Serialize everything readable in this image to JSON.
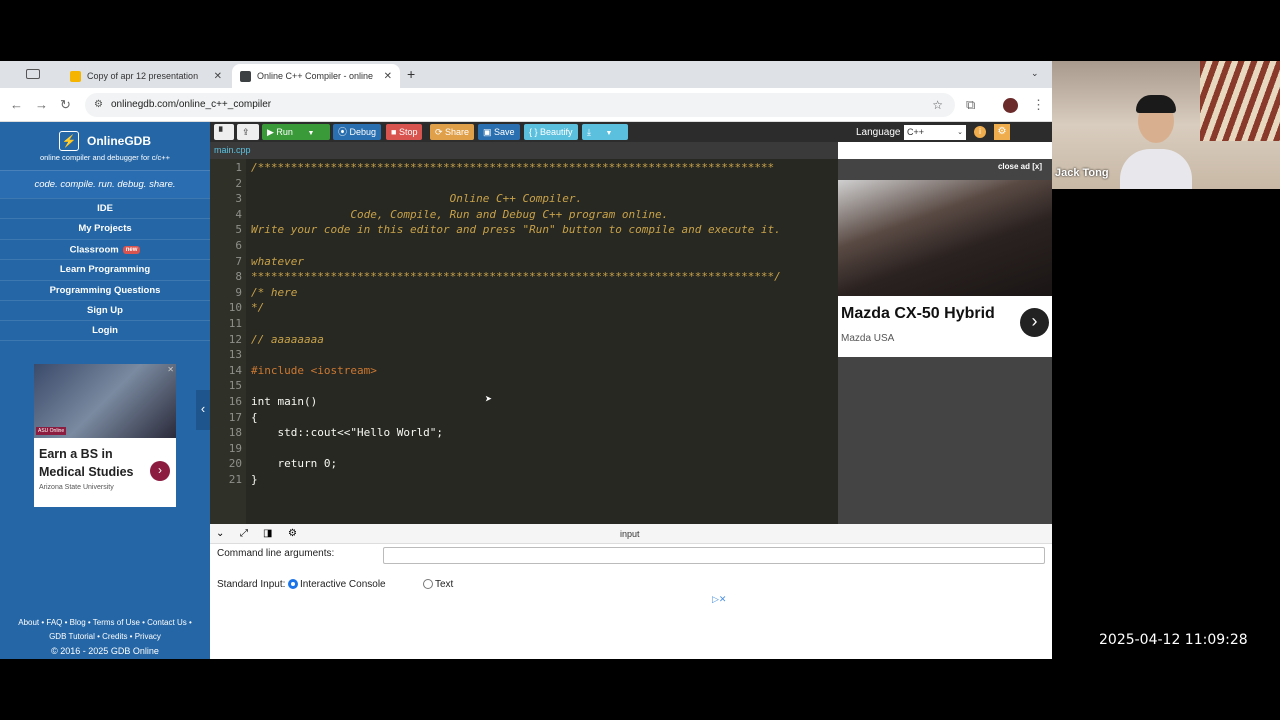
{
  "browser": {
    "tabs": [
      {
        "label": "Copy of apr 12 presentation",
        "active": false,
        "favicon_color": "#f4b400"
      },
      {
        "label": "Online C++ Compiler - online",
        "active": true,
        "favicon_color": "#3c4043"
      }
    ],
    "url": "onlinegdb.com/online_c++_compiler"
  },
  "sidebar": {
    "brand": "OnlineGDB",
    "tagline": "online compiler and debugger for c/c++",
    "motto": "code. compile. run. debug. share.",
    "nav": [
      {
        "label": "IDE"
      },
      {
        "label": "My Projects"
      },
      {
        "label": "Classroom",
        "badge": "new"
      },
      {
        "label": "Learn Programming"
      },
      {
        "label": "Programming Questions"
      },
      {
        "label": "Sign Up"
      },
      {
        "label": "Login"
      }
    ],
    "ad": {
      "headline": "Earn a BS in Medical Studies",
      "advertiser": "Arizona State University",
      "logo_text": "ASU Online"
    },
    "footer": {
      "links_line1": [
        "About",
        "FAQ",
        "Blog",
        "Terms of Use",
        "Contact Us"
      ],
      "links_line2": [
        "GDB Tutorial",
        "Credits",
        "Privacy"
      ],
      "copyright": "© 2016 - 2025 GDB Online"
    }
  },
  "toolbar": {
    "run_label": "Run",
    "debug_label": "Debug",
    "stop_label": "Stop",
    "share_label": "Share",
    "save_label": "Save",
    "beautify_label": "{ } Beautify",
    "language_label": "Language",
    "language_value": "C++",
    "colors": {
      "run": "#3a9a3a",
      "debug": "#2a6fb0",
      "stop": "#d9534f",
      "share": "#e0a04a",
      "save": "#2a6fb0",
      "beautify": "#5bc0de"
    }
  },
  "editor": {
    "filename": "main.cpp",
    "lines": [
      {
        "n": "1",
        "text": "/******************************************************************************",
        "cls": "cmt"
      },
      {
        "n": "2",
        "text": "",
        "cls": "cmt"
      },
      {
        "n": "3",
        "text": "                              Online C++ Compiler.",
        "cls": "cmt"
      },
      {
        "n": "4",
        "text": "               Code, Compile, Run and Debug C++ program online.",
        "cls": "cmt"
      },
      {
        "n": "5",
        "text": "Write your code in this editor and press \"Run\" button to compile and execute it.",
        "cls": "cmt"
      },
      {
        "n": "6",
        "text": "",
        "cls": "cmt"
      },
      {
        "n": "7",
        "text": "whatever",
        "cls": "cmt"
      },
      {
        "n": "8",
        "text": "*******************************************************************************/",
        "cls": "cmt"
      },
      {
        "n": "9",
        "text": "/* here",
        "cls": "cmt"
      },
      {
        "n": "10",
        "text": "*/",
        "cls": "cmt"
      },
      {
        "n": "11",
        "text": "",
        "cls": ""
      },
      {
        "n": "12",
        "text": "// aaaaaaaa",
        "cls": "cmt"
      },
      {
        "n": "13",
        "text": "",
        "cls": ""
      },
      {
        "n": "14",
        "text": "#include <iostream>",
        "cls": "pp"
      },
      {
        "n": "15",
        "text": "",
        "cls": ""
      },
      {
        "n": "16",
        "text": "int main()",
        "cls": ""
      },
      {
        "n": "17",
        "text": "{",
        "cls": ""
      },
      {
        "n": "18",
        "text": "    std::cout<<\"Hello World\";",
        "cls": ""
      },
      {
        "n": "19",
        "text": "",
        "cls": ""
      },
      {
        "n": "20",
        "text": "    return 0;",
        "cls": ""
      },
      {
        "n": "21",
        "text": "}",
        "cls": ""
      }
    ]
  },
  "ad_panel": {
    "close_label": "close ad [x]",
    "title": "Mazda CX-50 Hybrid",
    "advertiser": "Mazda USA"
  },
  "io": {
    "title": "input",
    "cmd_label": "Command line arguments:",
    "stdin_label": "Standard Input:",
    "option_console": "Interactive Console",
    "option_text": "Text"
  },
  "webcam": {
    "name": "Jack Tong"
  },
  "timestamp": "2025-04-12 11:09:28"
}
